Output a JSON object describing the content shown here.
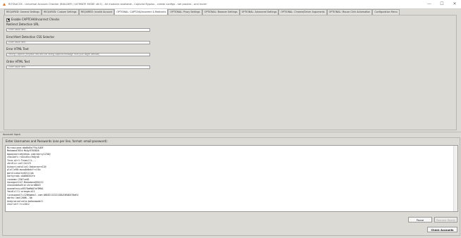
{
  "window": {
    "title": "ROTAACOS - Universal Account Checker (BUILDER / ULTIMATE MODE v8.5) - All modules available - Captcha Bypass - create configs - set proxies - and more!",
    "minimize_glyph": "—",
    "maximize_glyph": "☐",
    "close_glyph": "✕"
  },
  "tabs": [
    {
      "label": "REQUIRED: General Settings",
      "active": false
    },
    {
      "label": "REQUIRED: Custom Settings",
      "active": false
    },
    {
      "label": "REQUIRED: Invalid Account",
      "active": false
    },
    {
      "label": "OPTIONAL: CAPTCHA/Incorrect & Redirects",
      "active": true
    },
    {
      "label": "OPTIONAL: Proxy Settings",
      "active": false
    },
    {
      "label": "OPTIONAL: Browser Settings",
      "active": false
    },
    {
      "label": "OPTIONAL: Advanced Settings",
      "active": false
    },
    {
      "label": "OPTIONAL: Chrome/Driver Arguments",
      "active": false
    },
    {
      "label": "OPTIONAL: Mouse Click Automation",
      "active": false
    },
    {
      "label": "Configuration Menu",
      "active": false
    }
  ],
  "captcha": {
    "enable_label": "Enable CAPTCHA/Incorrect Checks",
    "enable_checked": true,
    "fields": [
      {
        "label": "Redirect Detection URL",
        "value": "",
        "placeholder": "Enter value here..."
      },
      {
        "label": "Error/Alert Detection CSS Selector",
        "value": "",
        "placeholder": "Enter value here..."
      },
      {
        "label": "Error HTML Text",
        "value": "",
        "placeholder": "Wrong Captcha (Replace this with the wrong captcha message from your target website)"
      },
      {
        "label": "Order HTML Text",
        "value": "",
        "placeholder": "Enter value here..."
      }
    ]
  },
  "accounts": {
    "section_label": "Account Input",
    "textarea_label": "Enter Usernames and Passwords (one per line, format: email:password):",
    "lines": [
      "Mirnaciana:dbd6d5e7FALSUDF",
      "Mohamed7054:MxQy9765826",
      "mgwayoorie@yahoo.com:marcy1234@",
      "chaioofi:ranid5cc7mQjk6",
      "Tesa.q1r1:Tesmilli...",
      "zbrdlcc:xoll2x123",
      "Ashayrivatolie1:Dakaroore12@",
      "plolle90:mouw0dbdcYrcl6c",
      "maroliokorey@2111ak",
      "Garhyrodi:oom08352fe",
      "roxanmc:2567ze01",
      "Xavegon1247:Mukadann@94212",
      "shovondeko5ld:shrord0643",
      "anonmfessia9570aMb07af9Mb1",
      "Ymidlill1:orange+k11",
      "lucaspaoolli120@gmail.com:UN182115221ZOUZ4RAD470aE4",
      "abrbs:1mol2006--ab",
      "Andyrainolvola:bahanaodell",
      "churlotf:trx1012"
    ]
  },
  "buttons": {
    "pause": "Pause",
    "resume": "Resume Ready",
    "check": "Check Accounts"
  }
}
